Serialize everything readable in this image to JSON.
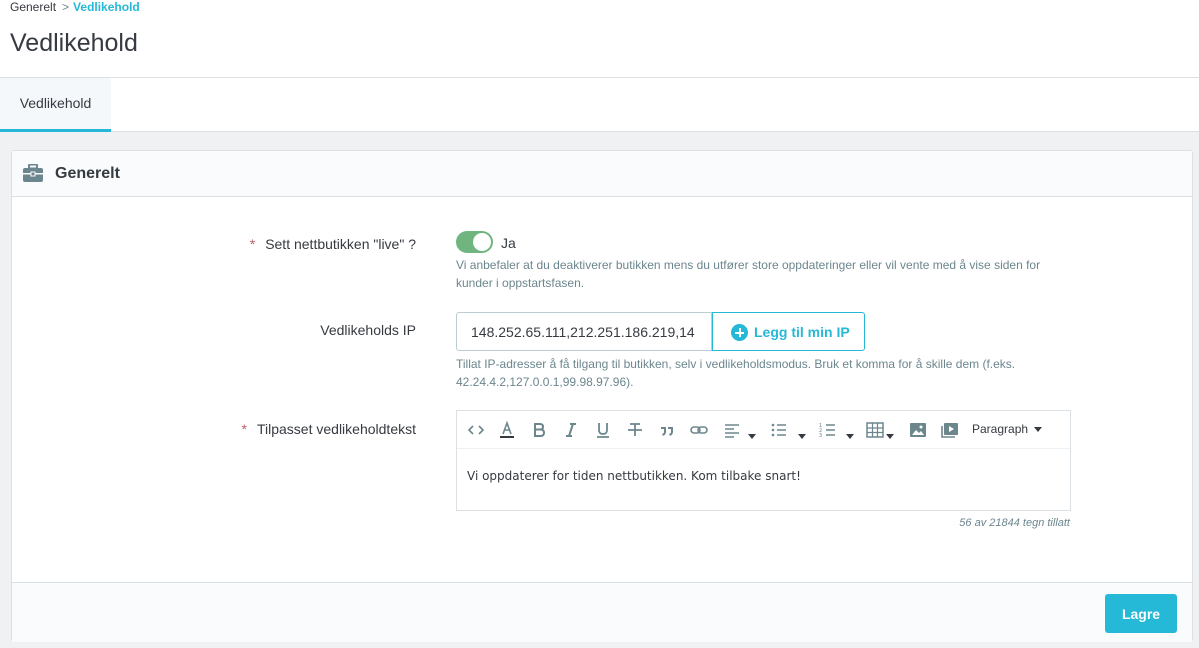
{
  "breadcrumb": {
    "parent": "Generelt",
    "separator": ">",
    "current": "Vedlikehold"
  },
  "page_title": "Vedlikehold",
  "tabs": [
    {
      "label": "Vedlikehold",
      "active": true
    }
  ],
  "card": {
    "title": "Generelt",
    "icon": "briefcase-icon",
    "shop_live": {
      "label": "Sett nettbutikken \"live\" ?",
      "required_mark": "*",
      "toggle_on": true,
      "toggle_label": "Ja",
      "help": "Vi anbefaler at du deaktiverer butikken mens du utfører store oppdateringer eller vil vente med å vise siden for kunder i oppstartsfasen."
    },
    "maintenance_ip": {
      "label": "Vedlikeholds IP",
      "value": "148.252.65.111,212.251.186.219,14",
      "button_label": "Legg til min IP",
      "button_icon": "plus-circle-icon",
      "help": "Tillat IP-adresser å få tilgang til butikken, selv i vedlikeholdsmodus. Bruk et komma for å skille dem (f.eks. 42.24.4.2,127.0.0.1,99.98.97.96)."
    },
    "maintenance_text": {
      "label": "Tilpasset vedlikeholdtekst",
      "required_mark": "*",
      "toolbar_format": "Paragraph",
      "content": "Vi oppdaterer for tiden nettbutikken. Kom tilbake snart!",
      "counter": "56 av 21844 tegn tillatt"
    }
  },
  "footer": {
    "save_label": "Lagre"
  },
  "colors": {
    "accent": "#25b9d7",
    "toggle_on": "#70b580",
    "required": "#c05c67"
  }
}
